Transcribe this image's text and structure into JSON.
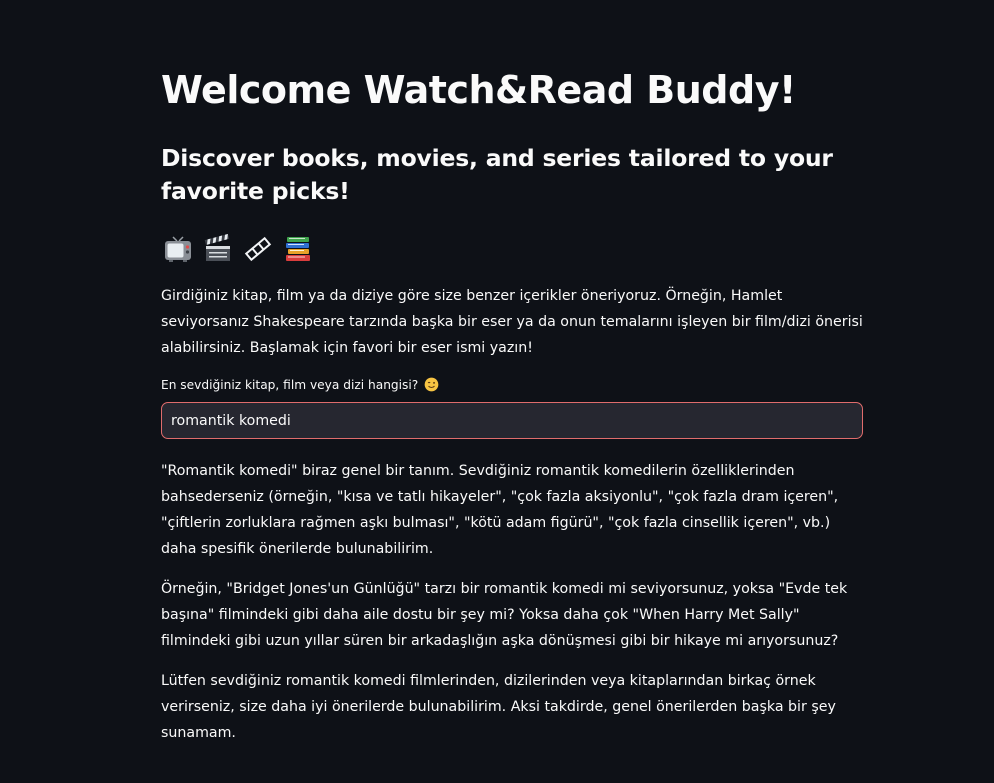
{
  "header": {
    "title": "Welcome Watch&Read Buddy!",
    "subtitle": "Discover books, movies, and series tailored to your favorite picks!"
  },
  "icons": [
    "tv-icon",
    "clapper-board-icon",
    "film-strip-icon",
    "books-icon"
  ],
  "intro": "Girdiğiniz kitap, film ya da diziye göre size benzer içerikler öneriyoruz. Örneğin, Hamlet seviyorsanız Shakespeare tarzında başka bir eser ya da onun temalarını işleyen bir film/dizi önerisi alabilirsiniz. Başlamak için favori bir eser ismi yazın!",
  "query": {
    "label": "En sevdiğiniz kitap, film veya dizi hangisi?",
    "label_icon": "winking-face-icon",
    "value": "romantik komedi"
  },
  "response": {
    "paragraphs": [
      "\"Romantik komedi\" biraz genel bir tanım. Sevdiğiniz romantik komedilerin özelliklerinden bahsederseniz (örneğin, \"kısa ve tatlı hikayeler\", \"çok fazla aksiyonlu\", \"çok fazla dram içeren\", \"çiftlerin zorluklara rağmen aşkı bulması\", \"kötü adam figürü\", \"çok fazla cinsellik içeren\", vb.) daha spesifik önerilerde bulunabilirim.",
      "Örneğin, \"Bridget Jones'un Günlüğü\" tarzı bir romantik komedi mi seviyorsunuz, yoksa \"Evde tek başına\" filmindeki gibi daha aile dostu bir şey mi? Yoksa daha çok \"When Harry Met Sally\" filmindeki gibi uzun yıllar süren bir arkadaşlığın aşka dönüşmesi gibi bir hikaye mi arıyorsunuz?",
      "Lütfen sevdiğiniz romantik komedi filmlerinden, dizilerinden veya kitaplarından birkaç örnek verirseniz, size daha iyi önerilerde bulunabilirim. Aksi takdirde, genel önerilerden başka bir şey sunamam."
    ]
  },
  "colors": {
    "background": "#0e1117",
    "text": "#fafafa",
    "input_background": "#262730",
    "input_focus_border": "#e06c6c"
  }
}
